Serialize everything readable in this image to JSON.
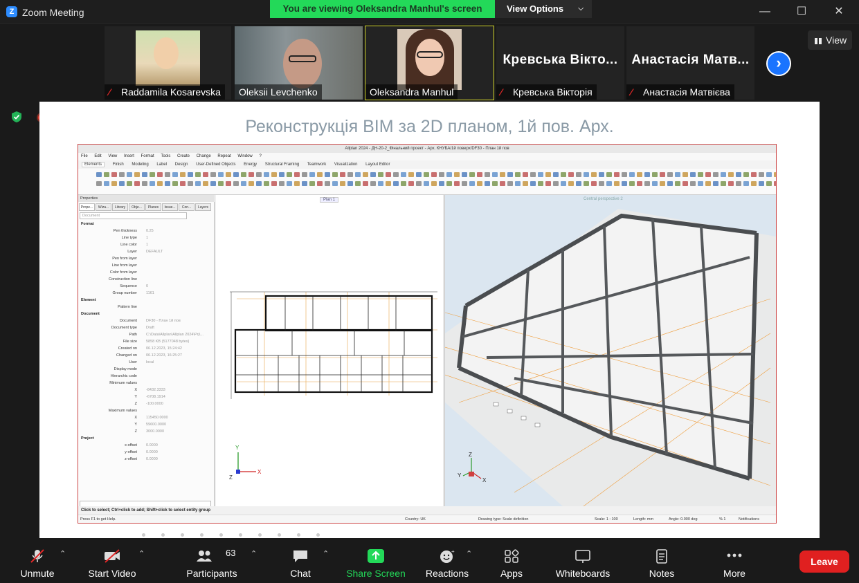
{
  "window": {
    "title": "Zoom Meeting"
  },
  "banner": {
    "text": "You are viewing Oleksandra Manhul's screen",
    "view_options": "View Options"
  },
  "participants": [
    {
      "name": "Raddamila Kosarevska",
      "muted": true,
      "video": true
    },
    {
      "name": "Oleksii Levchenko",
      "muted": false,
      "video": true
    },
    {
      "name": "Oleksandra Manhul",
      "muted": false,
      "video": true,
      "active": true
    },
    {
      "name": "Кревська Вікторія",
      "display": "Кревська Вікто...",
      "muted": true,
      "video": false
    },
    {
      "name": "Анастасія Матвієва",
      "display": "Анастасія Матв...",
      "muted": true,
      "video": false
    }
  ],
  "view_button": "View",
  "slide": {
    "title": "Реконструкція BIM за 2D планом, 1й пов. Арх.",
    "app_title": "Allplan 2024 - ДН-20-2_Фінальний проект - Арх. КНУБА/1й поверх/DF30 - План 1й пов",
    "menu": [
      "File",
      "Edit",
      "View",
      "Insert",
      "Format",
      "Tools",
      "Create",
      "Change",
      "Repeat",
      "Window",
      "?"
    ],
    "tabs": [
      "Elements",
      "Finish",
      "Modeling",
      "Label",
      "Design",
      "User-Defined Objects",
      "Energy",
      "Structural Framing",
      "Teamwork",
      "Visualization",
      "Layout Editor"
    ],
    "properties": {
      "tabs": [
        "Prope...",
        "Wiza...",
        "Library",
        "Obje...",
        "Planes",
        "Issue...",
        "Con...",
        "Layers"
      ],
      "filter": "Document",
      "rows": [
        {
          "section": "Format"
        },
        {
          "k": "Pen thickness",
          "v": "0.25"
        },
        {
          "k": "Line type",
          "v": "1"
        },
        {
          "k": "Line color",
          "v": "1"
        },
        {
          "k": "Layer",
          "v": "DEFAULT"
        },
        {
          "k": "Pen from layer",
          "v": ""
        },
        {
          "k": "Line from layer",
          "v": ""
        },
        {
          "k": "Color from layer",
          "v": ""
        },
        {
          "k": "Construction line",
          "v": ""
        },
        {
          "k": "Sequence",
          "v": "0"
        },
        {
          "k": "Group number",
          "v": "1161"
        },
        {
          "section": "Element"
        },
        {
          "k": "Pattern line",
          "v": ""
        },
        {
          "section": "Document"
        },
        {
          "k": "Document",
          "v": "DF30 - План 1й пов"
        },
        {
          "k": "Document type",
          "v": "Draft"
        },
        {
          "k": "Path",
          "v": "C:\\Data\\Allplan\\Allplan 2024\\Prj\\..."
        },
        {
          "k": "File size",
          "v": "5858 KB (5177048 bytes)"
        },
        {
          "k": "Created on",
          "v": "06.12.2023, 15:24:42"
        },
        {
          "k": "Changed on",
          "v": "06.12.2023, 16:25:27"
        },
        {
          "k": "User",
          "v": "local"
        },
        {
          "k": "Display mode",
          "v": ""
        },
        {
          "k": "Hierarchic code",
          "v": ""
        },
        {
          "k": "Minimum values",
          "v": ""
        },
        {
          "k": "X",
          "v": "-8432.3333"
        },
        {
          "k": "Y",
          "v": "-6708.1914"
        },
        {
          "k": "Z",
          "v": "-100.0000"
        },
        {
          "k": "Maximum values",
          "v": ""
        },
        {
          "k": "X",
          "v": "115450.0000"
        },
        {
          "k": "Y",
          "v": "59600.0000"
        },
        {
          "k": "Z",
          "v": "3000.0000"
        },
        {
          "section": "Project"
        },
        {
          "k": "x-offset",
          "v": "0.0000"
        },
        {
          "k": "y-offset",
          "v": "0.0000"
        },
        {
          "k": "z-offset",
          "v": "0.0000"
        }
      ]
    },
    "plan_label": "Plan 1",
    "persp_label": "Central perspective 2",
    "status": "Click to select; Ctrl+click to add; Shift+click to select entity group",
    "status2": {
      "help": "Press F1 to get Help.",
      "country": "Country:  UK",
      "drawing_type": "Drawing type:  Scale definition",
      "scale": "Scale:  1 : 100",
      "length": "Length:  mm",
      "angle": "Angle:  0.000  deg",
      "percent": "%  1",
      "notifications": "Notifications"
    }
  },
  "toolbar": {
    "unmute": "Unmute",
    "start_video": "Start Video",
    "participants": "Participants",
    "participants_count": "63",
    "chat": "Chat",
    "share_screen": "Share Screen",
    "reactions": "Reactions",
    "apps": "Apps",
    "whiteboards": "Whiteboards",
    "notes": "Notes",
    "more": "More",
    "leave": "Leave"
  },
  "colors": {
    "zoom_blue": "#2d8cff",
    "share_green": "#23d959",
    "leave_red": "#e02020",
    "mute_red": "#e02828"
  }
}
